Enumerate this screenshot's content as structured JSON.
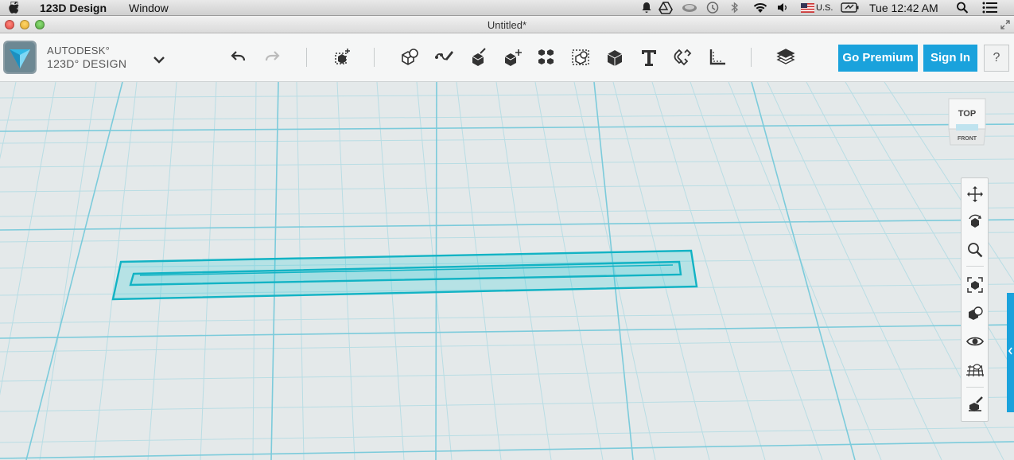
{
  "menubar": {
    "app_name": "123D Design",
    "window_menu": "Window",
    "input_source": "U.S.",
    "clock": "Tue 12:42 AM",
    "icons": [
      "apple-icon",
      "notification-icon",
      "drive-icon",
      "cloud-icon",
      "time-machine-icon",
      "bluetooth-icon",
      "wifi-icon",
      "volume-icon",
      "flag-us-icon",
      "battery-icon",
      "spotlight-icon",
      "notification-center-icon"
    ]
  },
  "window": {
    "title": "Untitled*"
  },
  "toolbar": {
    "brand_line1": "AUTODESK°",
    "brand_line2": "123D° DESIGN",
    "tools": [
      "undo",
      "redo",
      "transform",
      "primitives",
      "sketch",
      "construct",
      "modify",
      "pattern",
      "grouping",
      "combine",
      "text",
      "snap",
      "measure",
      "material"
    ],
    "premium_label": "Go Premium",
    "signin_label": "Sign In",
    "help_label": "?"
  },
  "viewcube": {
    "top_label": "TOP",
    "front_label": "FRONT"
  },
  "navbar": {
    "tools": [
      "pan",
      "orbit",
      "zoom",
      "fit",
      "view-mode",
      "visibility",
      "grid",
      "snap-settings"
    ]
  },
  "colors": {
    "accent": "#1aa2dc",
    "grid_bg": "#e4e9ea",
    "sketch": "#15b6c6"
  }
}
